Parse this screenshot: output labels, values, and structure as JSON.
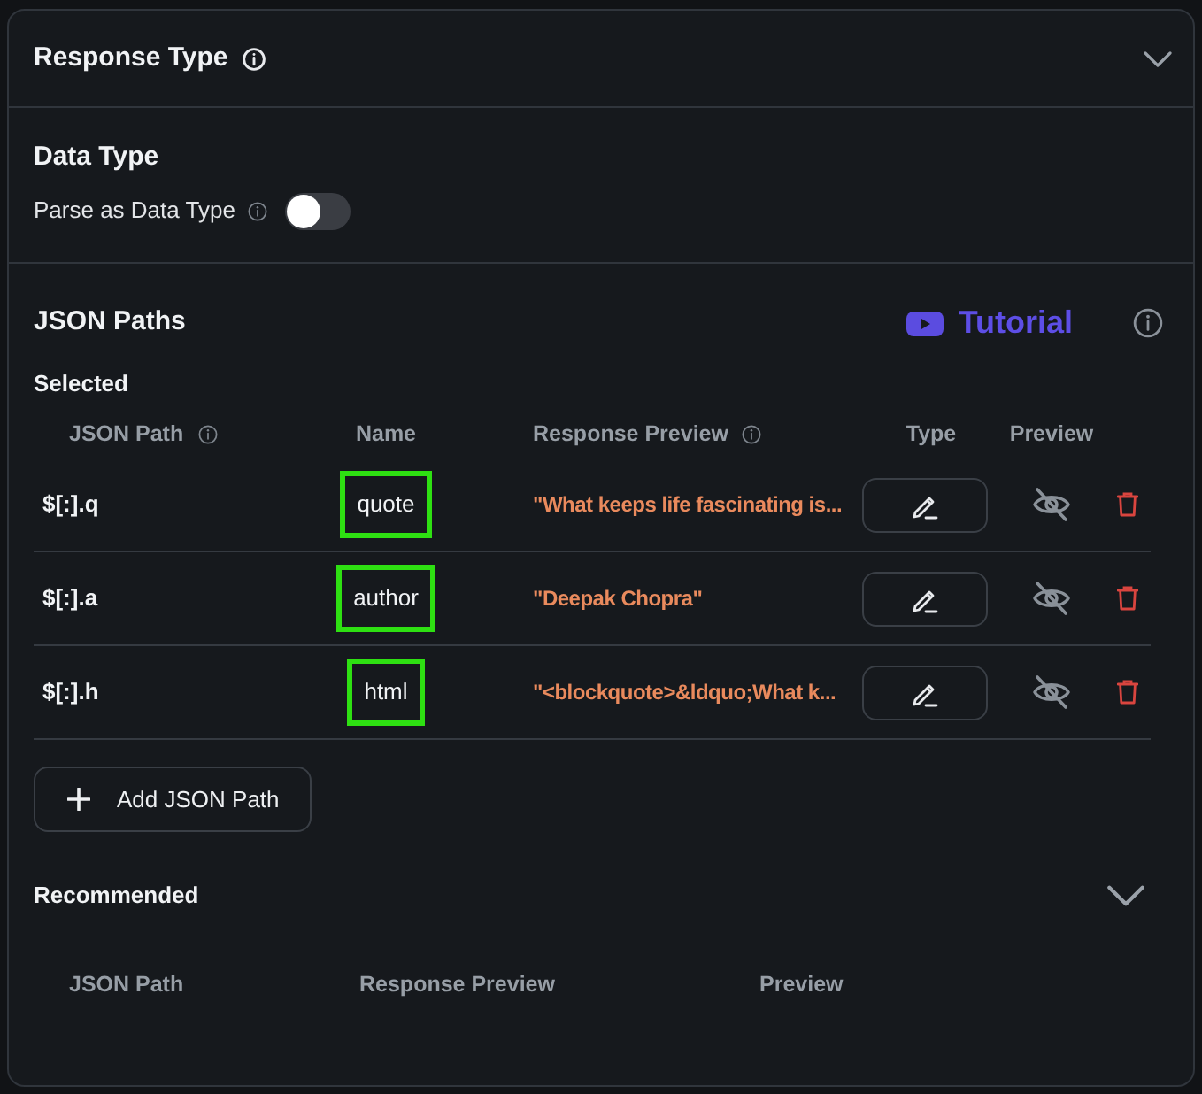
{
  "header": {
    "title": "Response Type"
  },
  "data_type": {
    "title": "Data Type",
    "toggle": {
      "label": "Parse as Data Type",
      "on": false
    }
  },
  "json_paths": {
    "title": "JSON Paths",
    "tutorial": "Tutorial",
    "selected_label": "Selected",
    "columns": [
      {
        "label": "JSON Path",
        "info": true
      },
      {
        "label": "Name",
        "info": false
      },
      {
        "label": "Response Preview",
        "info": true
      },
      {
        "label": "Type",
        "info": false
      },
      {
        "label": "Preview",
        "info": false
      }
    ],
    "rows": [
      {
        "path": "$[:].q",
        "name": "quote",
        "highlighted": true,
        "preview": "\"What keeps life fascinating is...",
        "preview_visible": false
      },
      {
        "path": "$[:].a",
        "name": "author",
        "highlighted": true,
        "preview": "\"Deepak Chopra\"",
        "preview_visible": false
      },
      {
        "path": "$[:].h",
        "name": "html",
        "highlighted": true,
        "preview": "\"<blockquote>&ldquo;What k...",
        "preview_visible": false
      }
    ],
    "add_button": "Add JSON Path"
  },
  "recommended": {
    "title": "Recommended",
    "columns": [
      "JSON Path",
      "Response Preview",
      "Preview"
    ]
  }
}
